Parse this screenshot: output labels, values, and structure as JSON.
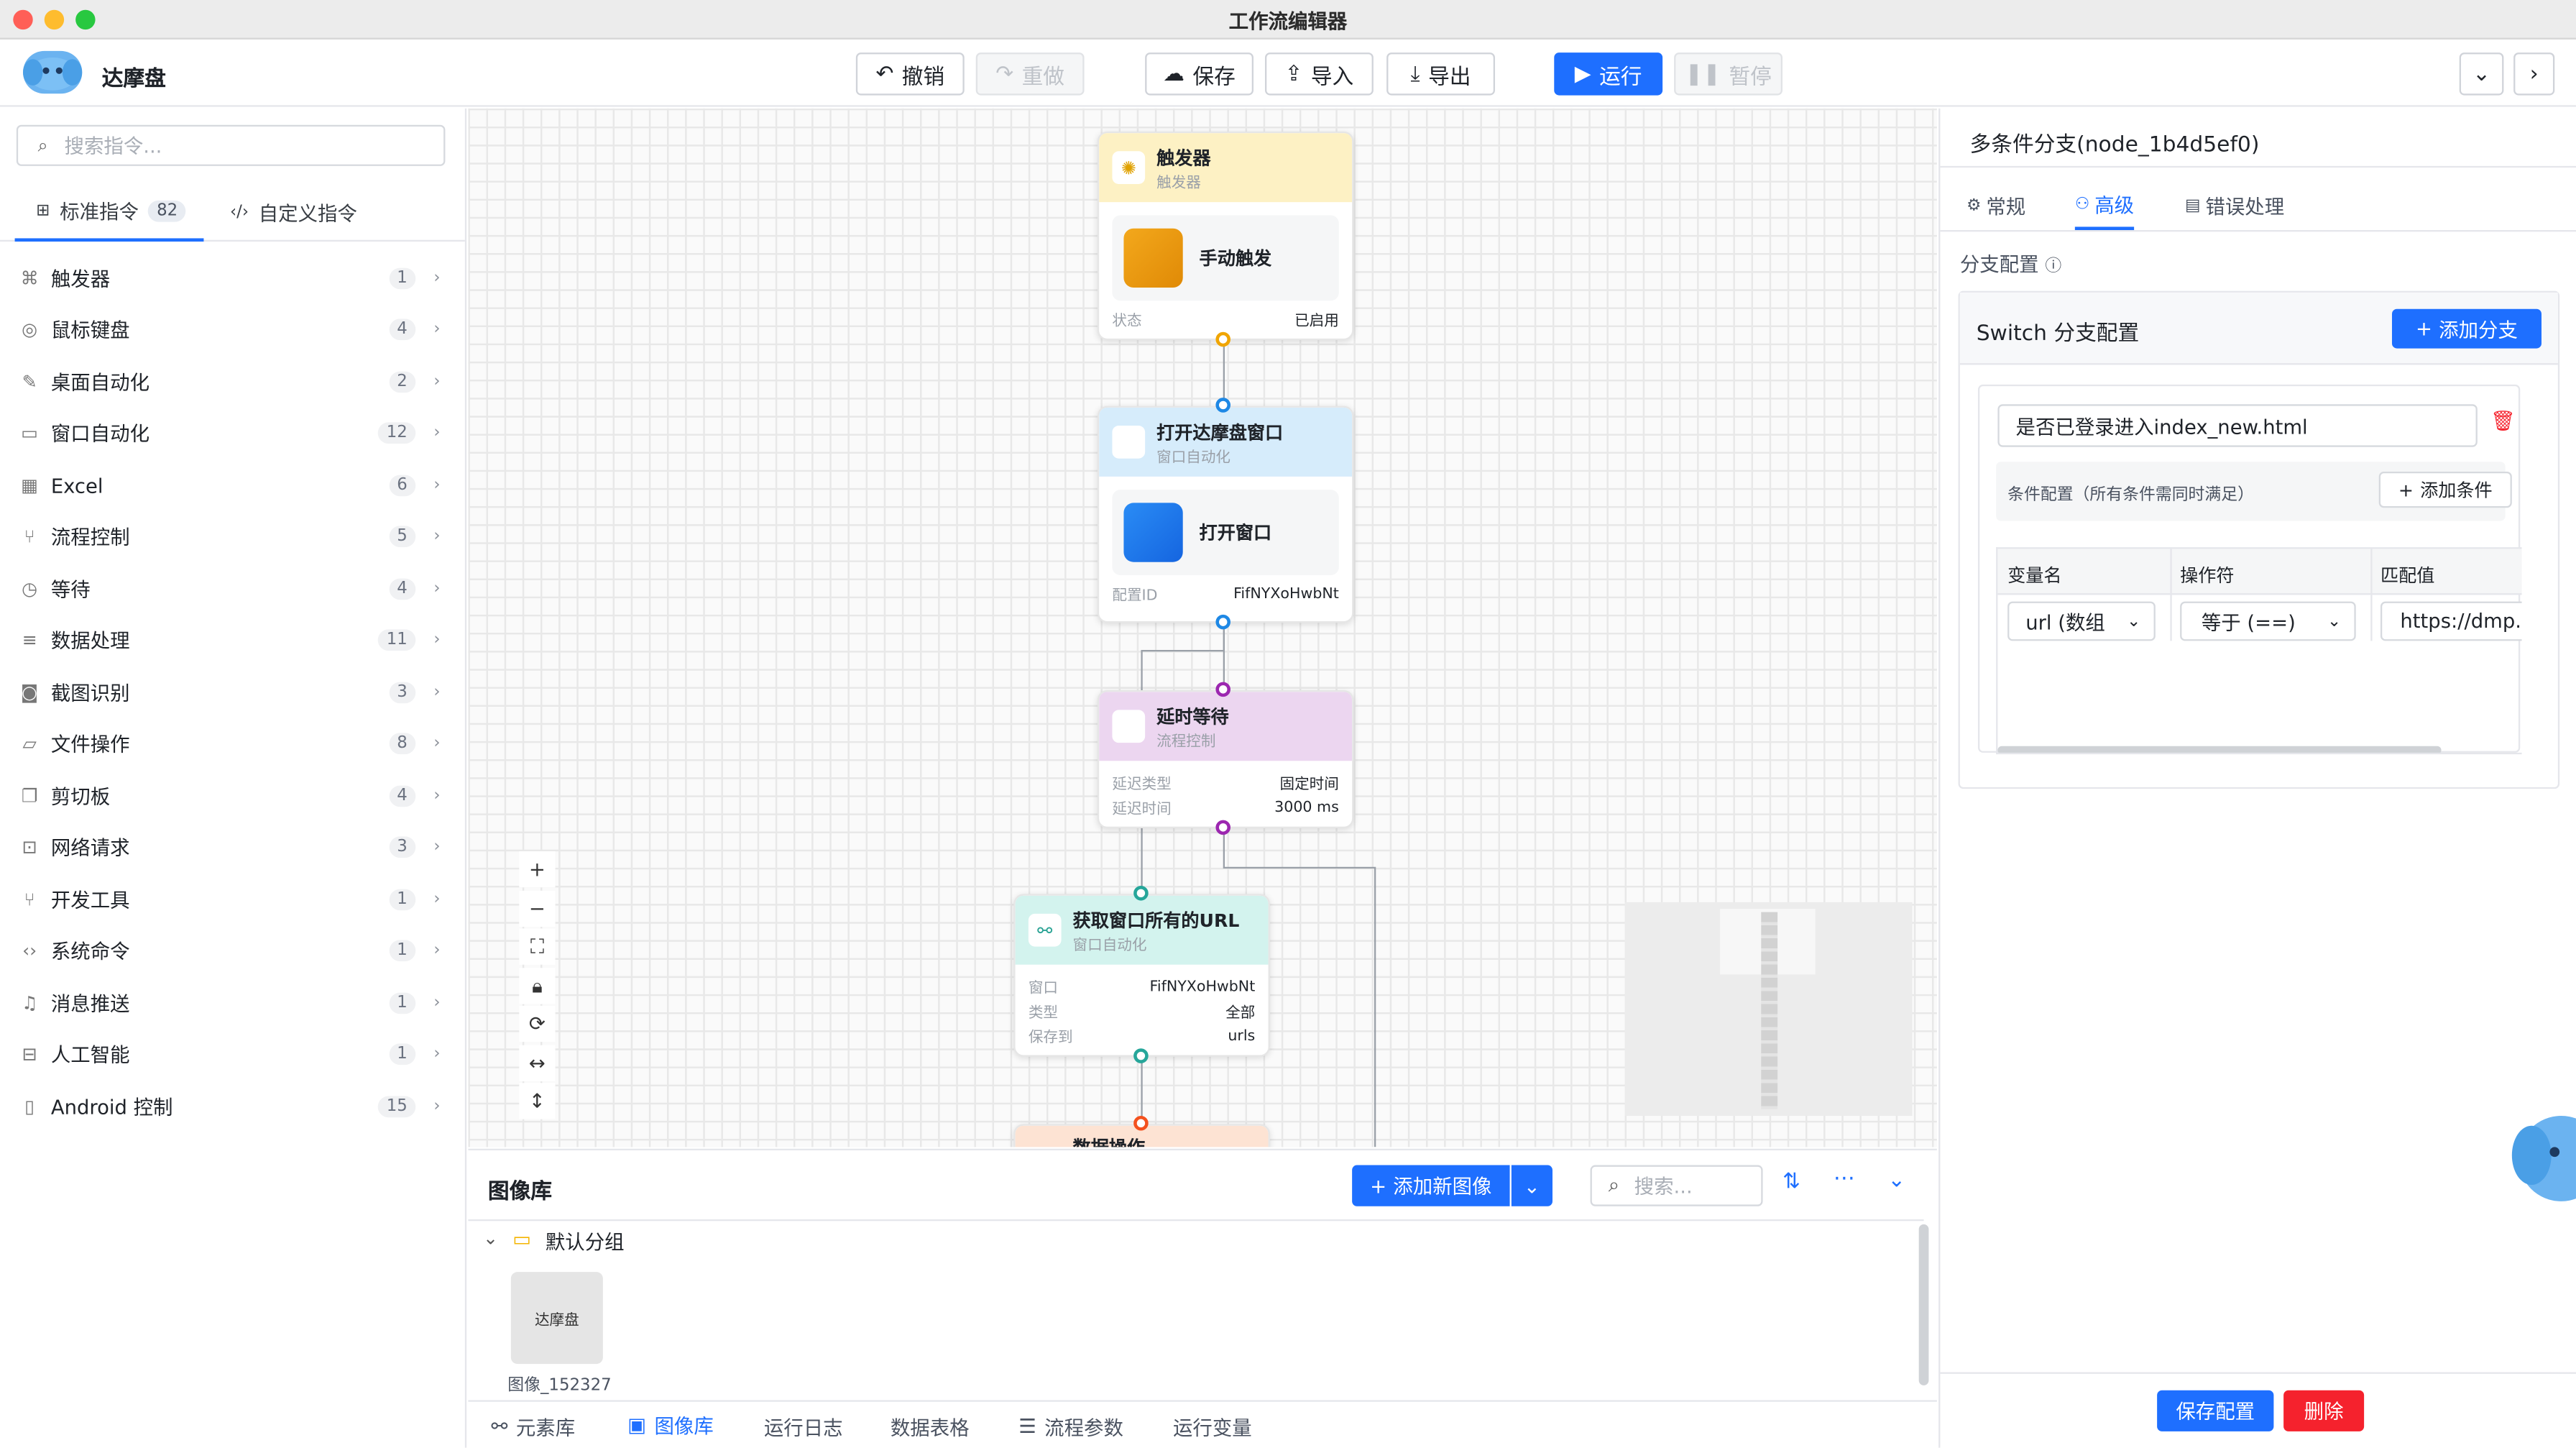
{
  "window": {
    "title": "工作流编辑器"
  },
  "app": {
    "name": "达摩盘"
  },
  "toolbar": {
    "undo": "撤销",
    "redo": "重做",
    "save": "保存",
    "import": "导入",
    "export": "导出",
    "run": "运行",
    "pause": "暂停"
  },
  "sidebar": {
    "search_placeholder": "搜索指令...",
    "tabs": [
      {
        "label": "标准指令",
        "count": "82"
      },
      {
        "label": "自定义指令"
      }
    ],
    "items": [
      {
        "label": "触发器",
        "count": "1",
        "icon": "trigger-icon"
      },
      {
        "label": "鼠标键盘",
        "count": "4",
        "icon": "mouse-icon"
      },
      {
        "label": "桌面自动化",
        "count": "2",
        "icon": "pen-icon"
      },
      {
        "label": "窗口自动化",
        "count": "12",
        "icon": "monitor-icon"
      },
      {
        "label": "Excel",
        "count": "6",
        "icon": "excel-icon"
      },
      {
        "label": "流程控制",
        "count": "5",
        "icon": "branch-icon"
      },
      {
        "label": "等待",
        "count": "4",
        "icon": "clock-icon"
      },
      {
        "label": "数据处理",
        "count": "11",
        "icon": "database-icon"
      },
      {
        "label": "截图识别",
        "count": "3",
        "icon": "camera-icon"
      },
      {
        "label": "文件操作",
        "count": "8",
        "icon": "folder-icon"
      },
      {
        "label": "剪切板",
        "count": "4",
        "icon": "clipboard-icon"
      },
      {
        "label": "网络请求",
        "count": "3",
        "icon": "network-icon"
      },
      {
        "label": "开发工具",
        "count": "1",
        "icon": "devtools-icon"
      },
      {
        "label": "系统命令",
        "count": "1",
        "icon": "code-icon"
      },
      {
        "label": "消息推送",
        "count": "1",
        "icon": "bell-icon"
      },
      {
        "label": "人工智能",
        "count": "1",
        "icon": "ai-icon"
      },
      {
        "label": "Android 控制",
        "count": "15",
        "icon": "phone-icon"
      }
    ]
  },
  "nodes": {
    "trigger": {
      "title": "触发器",
      "sub": "触发器",
      "inner": "手动触发",
      "k1": "状态",
      "v1": "已启用"
    },
    "open_window": {
      "title": "打开达摩盘窗口",
      "sub": "窗口自动化",
      "inner": "打开窗口",
      "k1": "配置ID",
      "v1": "FifNYXoHwbNt"
    },
    "delay": {
      "title": "延时等待",
      "sub": "流程控制",
      "k1": "延迟类型",
      "v1": "固定时间",
      "k2": "延迟时间",
      "v2": "3000 ms"
    },
    "get_urls": {
      "title": "获取窗口所有的URL",
      "sub": "窗口自动化",
      "k1": "窗口",
      "v1": "FifNYXoHwbNt",
      "k2": "类型",
      "v2": "全部",
      "k3": "保存到",
      "v3": "urls"
    },
    "data_op": {
      "title": "数据操作"
    }
  },
  "image_lib": {
    "title": "图像库",
    "add_button": "添加新图像",
    "search_placeholder": "搜索...",
    "group": "默认分组",
    "thumb_text": "达摩盘",
    "image_name": "图像_152327"
  },
  "bottom_tabs": [
    "元素库",
    "图像库",
    "运行日志",
    "数据表格",
    "流程参数",
    "运行变量"
  ],
  "right": {
    "title": "多条件分支(node_1b4d5ef0)",
    "tabs": [
      "常规",
      "高级",
      "错误处理"
    ],
    "section": "分支配置",
    "switch_title": "Switch 分支配置",
    "add_branch": "添加分支",
    "branch_name": "是否已登录进入index_new.html",
    "cond_label": "条件配置（所有条件需同时满足）",
    "add_cond": "添加条件",
    "columns": [
      "变量名",
      "操作符",
      "匹配值"
    ],
    "row": {
      "var": "url (数组",
      "op": "等于 (==)",
      "val": "https://dmp."
    },
    "save": "保存配置",
    "delete": "删除"
  }
}
